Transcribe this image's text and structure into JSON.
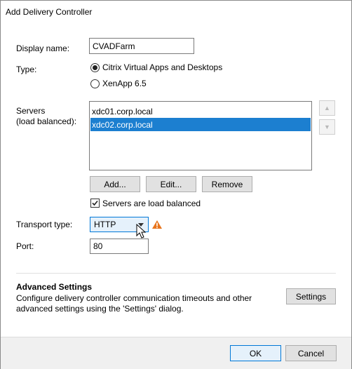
{
  "dialog": {
    "title": "Add Delivery Controller"
  },
  "display_name": {
    "label": "Display name:",
    "value": "CVADFarm"
  },
  "type": {
    "label": "Type:",
    "options": [
      {
        "label": "Citrix Virtual Apps and Desktops",
        "checked": true
      },
      {
        "label": "XenApp 6.5",
        "checked": false
      }
    ]
  },
  "servers": {
    "label_line1": "Servers",
    "label_line2": "(load balanced):",
    "items": [
      {
        "name": "xdc01.corp.local",
        "selected": false
      },
      {
        "name": "xdc02.corp.local",
        "selected": true
      }
    ],
    "add_label": "Add...",
    "edit_label": "Edit...",
    "remove_label": "Remove",
    "load_balanced_label": "Servers are load balanced",
    "load_balanced_checked": true
  },
  "transport": {
    "label": "Transport type:",
    "value": "HTTP",
    "warning_icon": "warning-icon"
  },
  "port": {
    "label": "Port:",
    "value": "80"
  },
  "advanced": {
    "heading": "Advanced Settings",
    "description_line1": "Configure delivery controller communication timeouts and other",
    "description_line2": "advanced settings using the 'Settings' dialog.",
    "settings_label": "Settings"
  },
  "footer": {
    "ok_label": "OK",
    "cancel_label": "Cancel"
  },
  "colors": {
    "selection": "#1c7fd0",
    "focus_border": "#0078d7",
    "warning": "#e8741c"
  }
}
